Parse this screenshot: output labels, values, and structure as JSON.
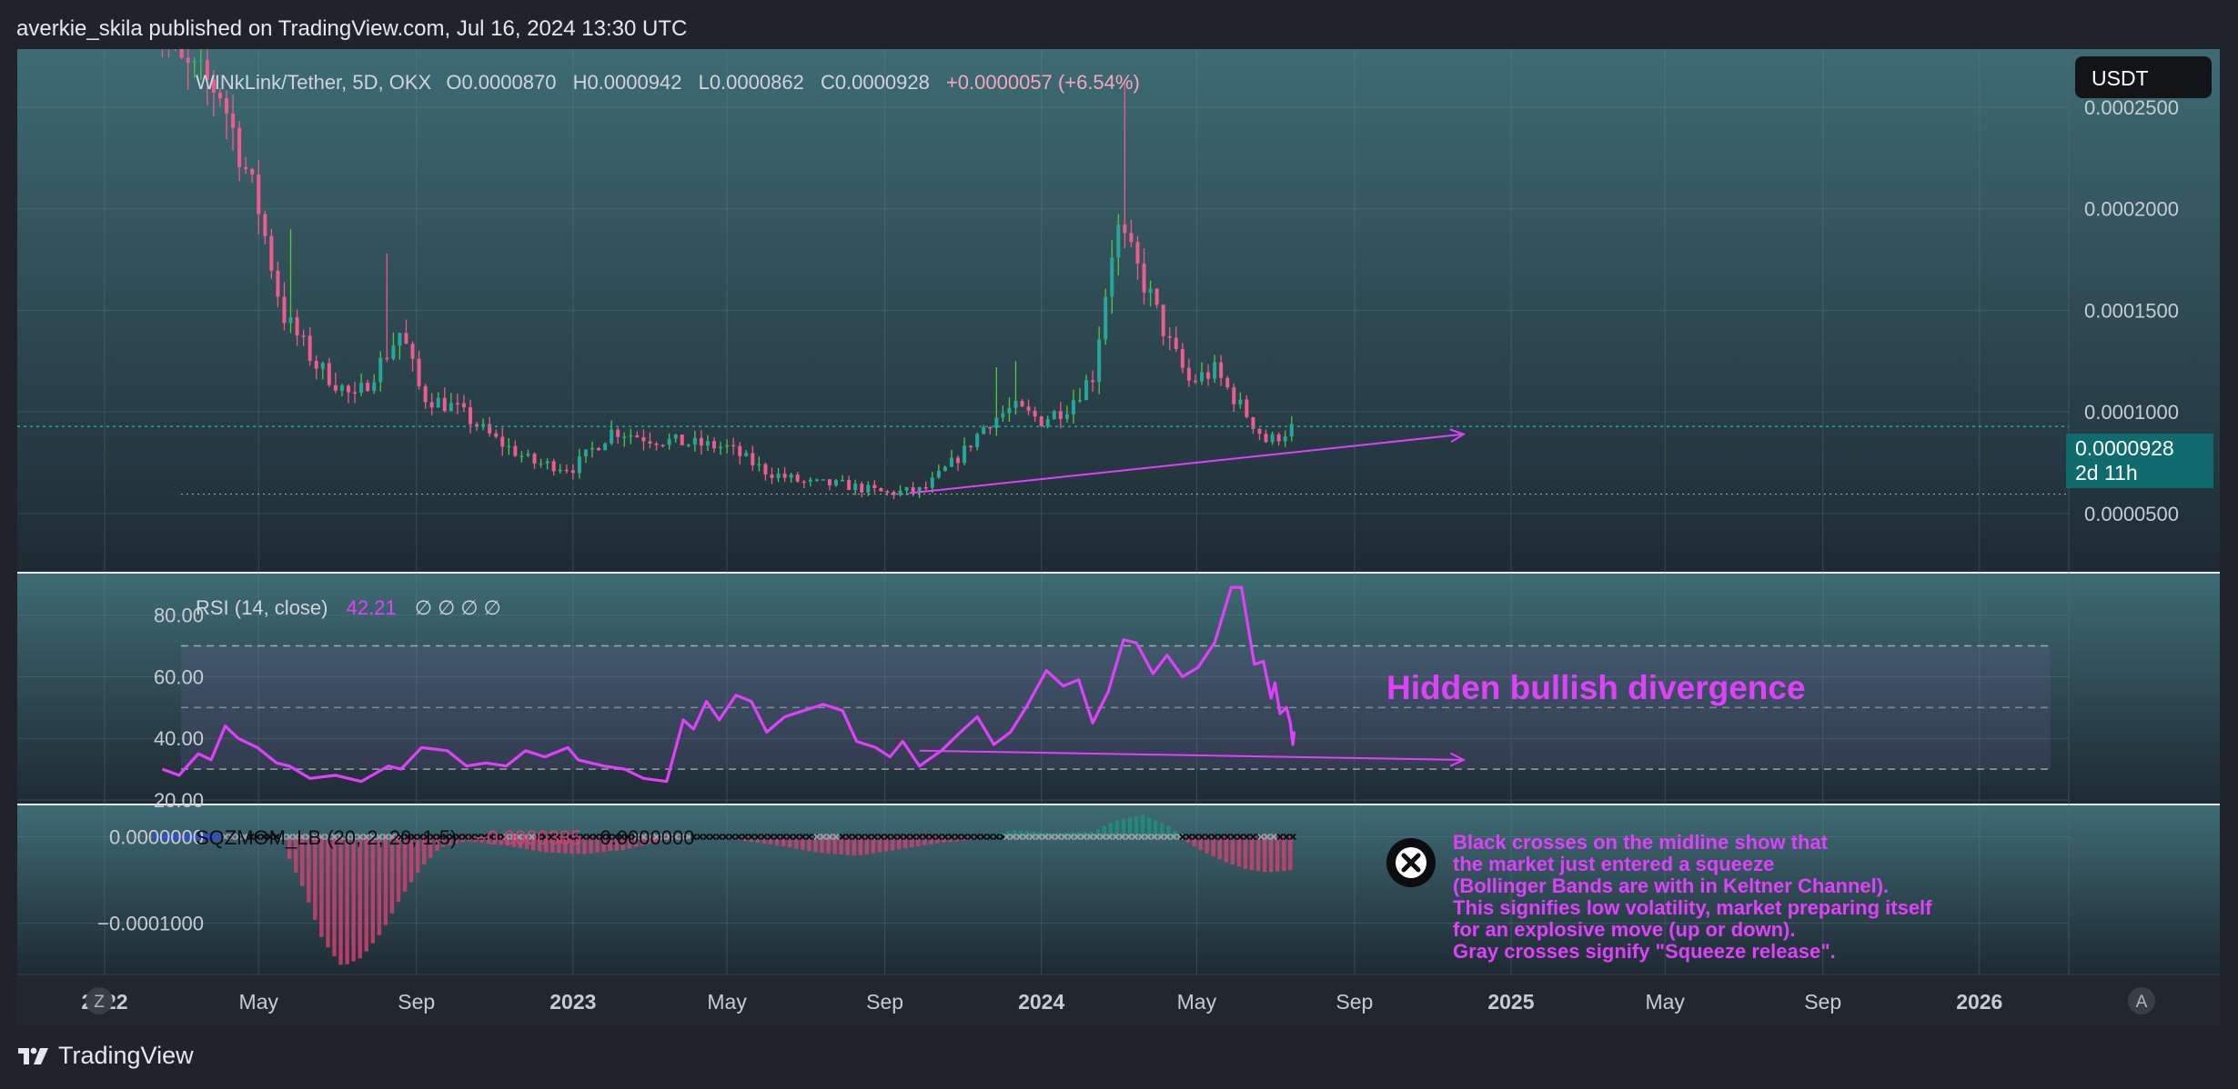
{
  "header": {
    "published": "averkie_skila published on TradingView.com, Jul 16, 2024 13:30 UTC"
  },
  "footer": {
    "brand": "TradingView"
  },
  "colors": {
    "up": "#26a69a",
    "up_wick": "#4ecb3d",
    "down": "#ef5b8c",
    "rsi": "#e040fb",
    "annotation": "#e040fb",
    "price_tag": "#0f6b6e",
    "hist_pos": "#1f8f7e",
    "hist_neg": "#d0406f"
  },
  "symbol_legend": {
    "name": "WINkLink/Tether, 5D, OKX",
    "o": "O0.0000870",
    "h": "H0.0000942",
    "l": "L0.0000862",
    "c": "C0.0000928",
    "change": "+0.0000057 (+6.54%)"
  },
  "currency_button": "USDT",
  "price_tag": {
    "price": "0.0000928",
    "countdown": "2d 11h"
  },
  "rsi_legend": {
    "name": "RSI (14, close)",
    "value": "42.21",
    "extras": "∅  ∅  ∅  ∅"
  },
  "sqz_legend": {
    "name": "SQZMOM_LB (20, 2, 20, 1.5)",
    "value": "−0.0000385",
    "value2": "0.0000000"
  },
  "annotations": {
    "divergence": "Hidden bullish divergence",
    "note_lines": [
      "Black crosses on the midline show that",
      "the market just entered a squeeze",
      "(Bollinger Bands are with in Keltner Channel).",
      "This signifies low volatility, market preparing itself",
      "for an explosive move (up or down).",
      "Gray crosses signify \"Squeeze release\"."
    ]
  },
  "time_axis": {
    "z_button": "Z",
    "a_button": "A",
    "labels": [
      "2022",
      "May",
      "Sep",
      "2023",
      "May",
      "Sep",
      "2024",
      "May",
      "Sep",
      "2025",
      "May",
      "Sep",
      "2026"
    ]
  },
  "chart_data": [
    {
      "type": "candlestick",
      "title": "WINkLink/Tether, 5D, OKX",
      "ylim": [
        2.8e-05,
        0.000275
      ],
      "y_ticks": [
        "0.0002500",
        "0.0002000",
        "0.0001500",
        "0.0001000",
        "0.0000500"
      ],
      "y_tick_values": [
        0.00025,
        0.0002,
        0.00015,
        0.0001,
        5e-05
      ],
      "x_range": [
        "2022-01-01",
        "2026-03-01"
      ],
      "series": [
        {
          "name": "close",
          "points": [
            [
              "2022-02-05",
              0.000305
            ],
            [
              "2022-03-01",
              0.00027
            ],
            [
              "2022-04-01",
              0.000258
            ],
            [
              "2022-05-01",
              0.0002
            ],
            [
              "2022-05-20",
              0.000148
            ],
            [
              "2022-06-15",
              0.000123
            ],
            [
              "2022-07-15",
              0.000106
            ],
            [
              "2022-08-05",
              0.000125
            ],
            [
              "2022-08-20",
              0.00014
            ],
            [
              "2022-09-05",
              0.000108
            ],
            [
              "2022-10-01",
              0.000102
            ],
            [
              "2022-11-01",
              8.65e-05
            ],
            [
              "2022-12-01",
              7.5e-05
            ],
            [
              "2023-01-01",
              7.25e-05
            ],
            [
              "2023-02-01",
              9.1e-05
            ],
            [
              "2023-03-01",
              8.7e-05
            ],
            [
              "2023-04-01",
              8.45e-05
            ],
            [
              "2023-05-01",
              8.25e-05
            ],
            [
              "2023-06-01",
              7.05e-05
            ],
            [
              "2023-07-01",
              6.5e-05
            ],
            [
              "2023-08-01",
              6.4e-05
            ],
            [
              "2023-09-01",
              6e-05
            ],
            [
              "2023-10-01",
              6.15e-05
            ],
            [
              "2023-11-01",
              8e-05
            ],
            [
              "2023-11-20",
              9.5e-05
            ],
            [
              "2023-12-10",
              0.000102
            ],
            [
              "2024-01-01",
              9.6e-05
            ],
            [
              "2024-01-20",
              0.000102
            ],
            [
              "2024-02-10",
              0.000118
            ],
            [
              "2024-02-28",
              0.000192
            ],
            [
              "2024-03-10",
              0.000178
            ],
            [
              "2024-03-25",
              0.000158
            ],
            [
              "2024-04-10",
              0.000133
            ],
            [
              "2024-04-25",
              0.000115
            ],
            [
              "2024-05-15",
              0.00012
            ],
            [
              "2024-06-05",
              0.000102
            ],
            [
              "2024-06-25",
              8.5e-05
            ],
            [
              "2024-07-16",
              9.28e-05
            ]
          ]
        }
      ],
      "trendline": {
        "from": [
          "2023-09-20",
          6e-05
        ],
        "to": [
          "2024-11-25",
          8.9e-05
        ]
      }
    },
    {
      "type": "line",
      "title": "RSI (14, close)",
      "ylim": [
        20,
        92
      ],
      "y_ticks": [
        "80.00",
        "60.00",
        "40.00",
        "20.00"
      ],
      "y_tick_values": [
        80,
        60,
        40,
        20
      ],
      "bands": {
        "upper": 70,
        "middle": 50,
        "lower": 30
      },
      "series": [
        {
          "name": "RSI",
          "points": [
            [
              "2022-02-15",
              30
            ],
            [
              "2022-02-28",
              28
            ],
            [
              "2022-03-15",
              35
            ],
            [
              "2022-03-25",
              33
            ],
            [
              "2022-04-05",
              44
            ],
            [
              "2022-04-15",
              40
            ],
            [
              "2022-04-30",
              37
            ],
            [
              "2022-05-15",
              32
            ],
            [
              "2022-05-25",
              31
            ],
            [
              "2022-06-10",
              27
            ],
            [
              "2022-06-30",
              28
            ],
            [
              "2022-07-20",
              26
            ],
            [
              "2022-08-10",
              31
            ],
            [
              "2022-08-20",
              30
            ],
            [
              "2022-09-05",
              37
            ],
            [
              "2022-09-25",
              36
            ],
            [
              "2022-10-10",
              31
            ],
            [
              "2022-10-25",
              32
            ],
            [
              "2022-11-10",
              31
            ],
            [
              "2022-11-25",
              36
            ],
            [
              "2022-12-10",
              34
            ],
            [
              "2022-12-28",
              37
            ],
            [
              "2023-01-05",
              33
            ],
            [
              "2023-01-25",
              31
            ],
            [
              "2023-02-10",
              30
            ],
            [
              "2023-02-25",
              27
            ],
            [
              "2023-03-15",
              26
            ],
            [
              "2023-03-28",
              46
            ],
            [
              "2023-04-05",
              43
            ],
            [
              "2023-04-15",
              52
            ],
            [
              "2023-04-25",
              46
            ],
            [
              "2023-05-08",
              54
            ],
            [
              "2023-05-20",
              52
            ],
            [
              "2023-06-01",
              42
            ],
            [
              "2023-06-15",
              47
            ],
            [
              "2023-06-30",
              49
            ],
            [
              "2023-07-15",
              51
            ],
            [
              "2023-07-30",
              49
            ],
            [
              "2023-08-10",
              39
            ],
            [
              "2023-08-25",
              37
            ],
            [
              "2023-09-05",
              34
            ],
            [
              "2023-09-15",
              39
            ],
            [
              "2023-09-28",
              31
            ],
            [
              "2023-10-15",
              36
            ],
            [
              "2023-10-30",
              42
            ],
            [
              "2023-11-12",
              47
            ],
            [
              "2023-11-25",
              38
            ],
            [
              "2023-12-08",
              42
            ],
            [
              "2023-12-20",
              50
            ],
            [
              "2024-01-05",
              62
            ],
            [
              "2024-01-18",
              57
            ],
            [
              "2024-01-30",
              59
            ],
            [
              "2024-02-10",
              45
            ],
            [
              "2024-02-22",
              55
            ],
            [
              "2024-03-05",
              72
            ],
            [
              "2024-03-15",
              71
            ],
            [
              "2024-03-28",
              61
            ],
            [
              "2024-04-08",
              67
            ],
            [
              "2024-04-20",
              60
            ],
            [
              "2024-05-02",
              63
            ],
            [
              "2024-05-15",
              71
            ],
            [
              "2024-05-28",
              89
            ],
            [
              "2024-06-05",
              89
            ],
            [
              "2024-06-15",
              64
            ],
            [
              "2024-06-22",
              65
            ],
            [
              "2024-06-28",
              53
            ],
            [
              "2024-07-01",
              58
            ],
            [
              "2024-07-05",
              48
            ],
            [
              "2024-07-10",
              50
            ],
            [
              "2024-07-13",
              45
            ],
            [
              "2024-07-15",
              38
            ],
            [
              "2024-07-16",
              42.21
            ]
          ]
        }
      ],
      "trendline": {
        "from": [
          "2023-09-28",
          36
        ],
        "to": [
          "2024-11-25",
          33
        ]
      }
    },
    {
      "type": "bar",
      "title": "SQZMOM_LB (20, 2, 20, 1.5)",
      "ylim": [
        -0.000155,
        3e-05
      ],
      "y_ticks": [
        "0.0000000",
        "−0.0001000"
      ],
      "y_tick_values": [
        0,
        -0.0001
      ],
      "series": [
        {
          "name": "momentum",
          "points": [
            [
              "2022-05-20",
              -1e-05
            ],
            [
              "2022-06-05",
              -6e-05
            ],
            [
              "2022-06-20",
              -0.00012
            ],
            [
              "2022-07-05",
              -0.00015
            ],
            [
              "2022-07-20",
              -0.00014
            ],
            [
              "2022-08-05",
              -0.00011
            ],
            [
              "2022-08-20",
              -7e-05
            ],
            [
              "2022-09-05",
              -3.5e-05
            ],
            [
              "2022-09-20",
              -1.2e-05
            ],
            [
              "2022-10-10",
              -5e-06
            ],
            [
              "2022-11-10",
              -1e-05
            ],
            [
              "2022-12-10",
              -1.8e-05
            ],
            [
              "2023-01-10",
              -2e-05
            ],
            [
              "2023-02-10",
              -1.5e-05
            ],
            [
              "2023-03-10",
              -5e-06
            ],
            [
              "2023-04-10",
              2e-06
            ],
            [
              "2023-05-10",
              -4e-06
            ],
            [
              "2023-06-10",
              -1e-05
            ],
            [
              "2023-07-10",
              -1.8e-05
            ],
            [
              "2023-08-10",
              -2.2e-05
            ],
            [
              "2023-09-10",
              -1.5e-05
            ],
            [
              "2023-10-10",
              -8e-06
            ],
            [
              "2023-11-10",
              -3e-06
            ],
            [
              "2023-12-10",
              8e-06
            ],
            [
              "2024-01-10",
              4e-06
            ],
            [
              "2024-02-10",
              6e-06
            ],
            [
              "2024-03-01",
              2e-05
            ],
            [
              "2024-03-20",
              2.5e-05
            ],
            [
              "2024-04-10",
              1.2e-05
            ],
            [
              "2024-04-25",
              -8e-06
            ],
            [
              "2024-05-10",
              -2e-05
            ],
            [
              "2024-05-25",
              -3e-05
            ],
            [
              "2024-06-10",
              -3.8e-05
            ],
            [
              "2024-06-25",
              -4.1e-05
            ],
            [
              "2024-07-16",
              -3.85e-05
            ]
          ]
        }
      ]
    }
  ]
}
